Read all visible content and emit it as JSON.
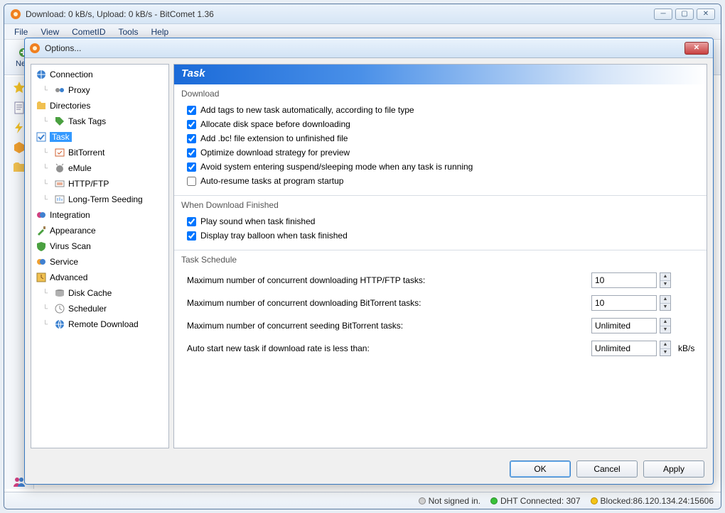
{
  "main": {
    "title": "Download: 0 kB/s, Upload: 0 kB/s - BitComet 1.36",
    "menu": [
      "File",
      "View",
      "CometID",
      "Tools",
      "Help"
    ],
    "toolbarNew": "New",
    "status": {
      "signin": "Not signed in.",
      "dht": "DHT Connected: 307",
      "blocked": "Blocked:86.120.134.24:15606"
    }
  },
  "dialog": {
    "title": "Options...",
    "tree": {
      "connection": "Connection",
      "proxy": "Proxy",
      "directories": "Directories",
      "taskTags": "Task Tags",
      "task": "Task",
      "bittorrent": "BitTorrent",
      "emule": "eMule",
      "httpftp": "HTTP/FTP",
      "longterm": "Long-Term Seeding",
      "integration": "Integration",
      "appearance": "Appearance",
      "virus": "Virus Scan",
      "service": "Service",
      "advanced": "Advanced",
      "diskcache": "Disk Cache",
      "scheduler": "Scheduler",
      "remote": "Remote Download"
    },
    "panel": {
      "header": "Task",
      "groupDownload": "Download",
      "cbTags": "Add tags to new task automatically, according to file type",
      "cbAllocate": "Allocate disk space before downloading",
      "cbBcExt": "Add .bc! file extension to unfinished file",
      "cbOptimize": "Optimize download strategy for preview",
      "cbSuspend": "Avoid system entering suspend/sleeping mode when any task is running",
      "cbAutoResume": "Auto-resume tasks at program startup",
      "groupFinished": "When Download Finished",
      "cbSound": "Play sound when task finished",
      "cbBalloon": "Display tray balloon when task finished",
      "groupSchedule": "Task Schedule",
      "maxHttp": "Maximum number of concurrent downloading HTTP/FTP tasks:",
      "maxHttpVal": "10",
      "maxBt": "Maximum number of concurrent downloading BitTorrent tasks:",
      "maxBtVal": "10",
      "maxSeed": "Maximum number of concurrent seeding BitTorrent tasks:",
      "maxSeedVal": "Unlimited",
      "autoStart": "Auto start new task if download rate is less than:",
      "autoStartVal": "Unlimited",
      "autoStartUnit": "kB/s"
    },
    "buttons": {
      "ok": "OK",
      "cancel": "Cancel",
      "apply": "Apply"
    }
  }
}
